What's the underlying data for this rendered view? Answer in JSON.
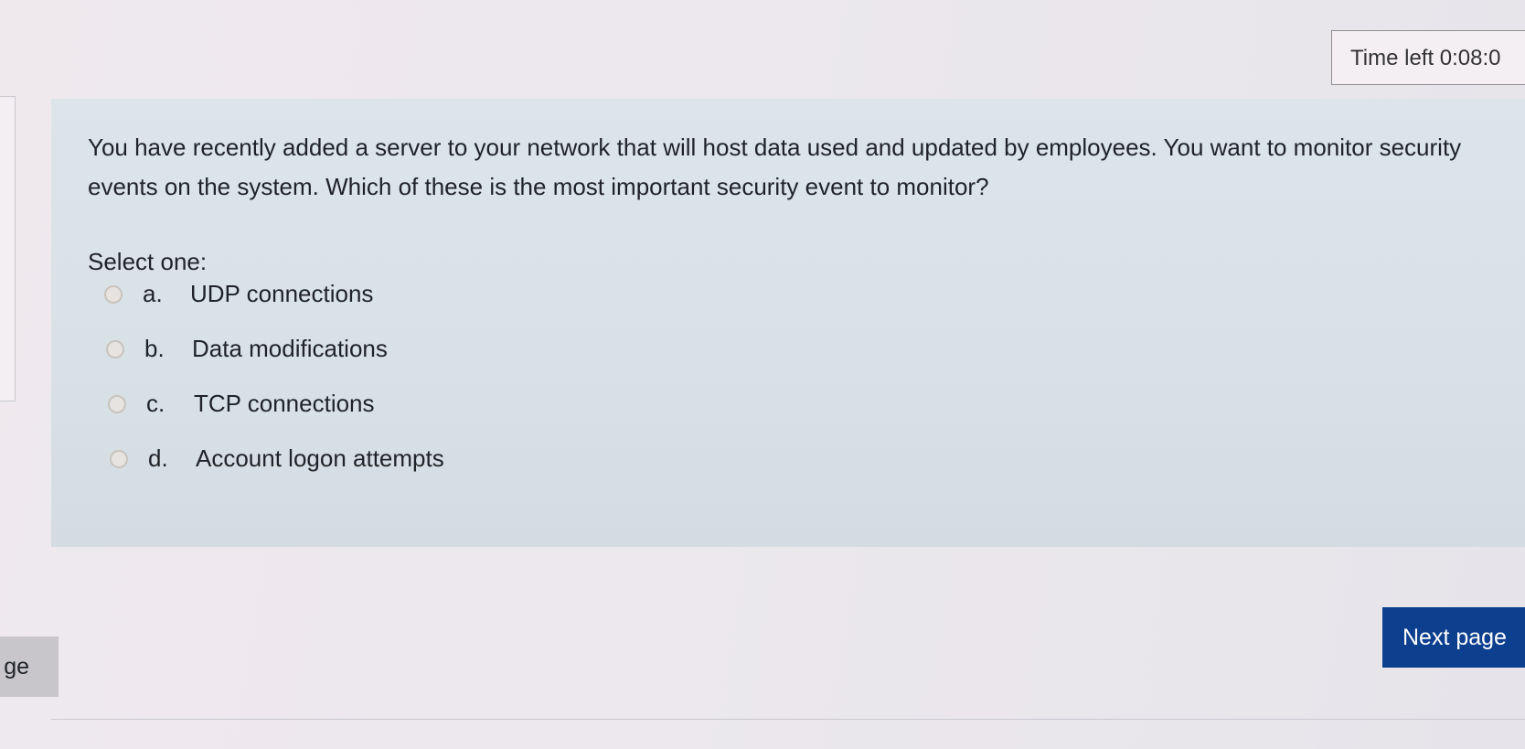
{
  "timer": {
    "text": "Time left 0:08:0"
  },
  "question": {
    "text": "You have recently added a server to your network that will host data used and updated by employees. You want to monitor security events on the system. Which of these is the most important security event to monitor?",
    "select_prompt": "Select one:",
    "options": [
      {
        "letter": "a.",
        "label": "UDP connections"
      },
      {
        "letter": "b.",
        "label": "Data modifications"
      },
      {
        "letter": "c.",
        "label": "TCP connections"
      },
      {
        "letter": "d.",
        "label": "Account logon attempts"
      }
    ]
  },
  "navigation": {
    "next_label": "Next page",
    "prev_label_partial": "ge"
  },
  "colors": {
    "next_button_bg": "#0d3f8f",
    "question_bg": "#d8e1e6"
  }
}
